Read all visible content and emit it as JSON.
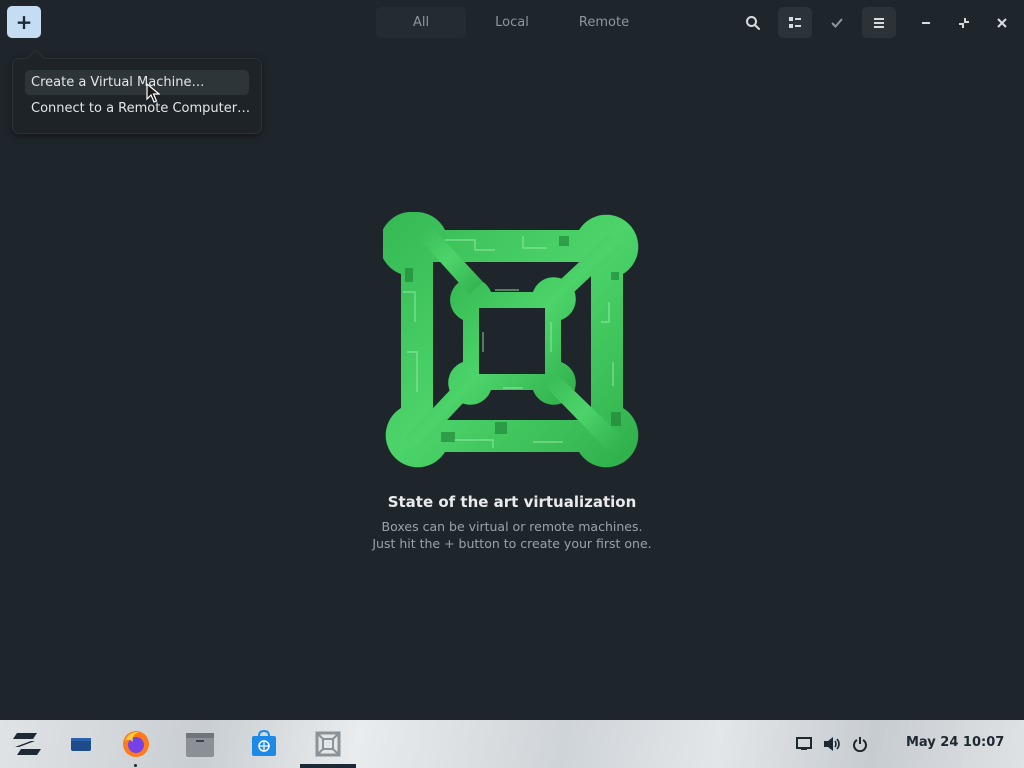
{
  "header": {
    "new_button_label": "+",
    "view_tabs": [
      {
        "label": "All",
        "active": true
      },
      {
        "label": "Local",
        "active": false
      },
      {
        "label": "Remote",
        "active": false
      }
    ],
    "icons": [
      "search-icon",
      "view-grid-icon",
      "select-check-icon",
      "menu-icon",
      "minimize-icon",
      "restore-icon",
      "close-icon"
    ]
  },
  "popover": {
    "items": [
      {
        "label": "Create a Virtual Machine…",
        "hover": true
      },
      {
        "label": "Connect to a Remote Computer…",
        "hover": false
      }
    ]
  },
  "empty_state": {
    "title": "State of the art virtualization",
    "line1": "Boxes can be virtual or remote machines.",
    "line2": "Just hit the + button to create your first one."
  },
  "taskbar": {
    "apps": [
      "zorin-menu-icon",
      "workspace-icon",
      "firefox-icon",
      "files-icon",
      "software-store-icon",
      "boxes-icon"
    ],
    "active_app": "boxes-icon",
    "clock": "May 24  10:07"
  },
  "colors": {
    "accent": "#c4ddf3",
    "background": "#1f262b",
    "logo_green": "#3fc75a"
  }
}
